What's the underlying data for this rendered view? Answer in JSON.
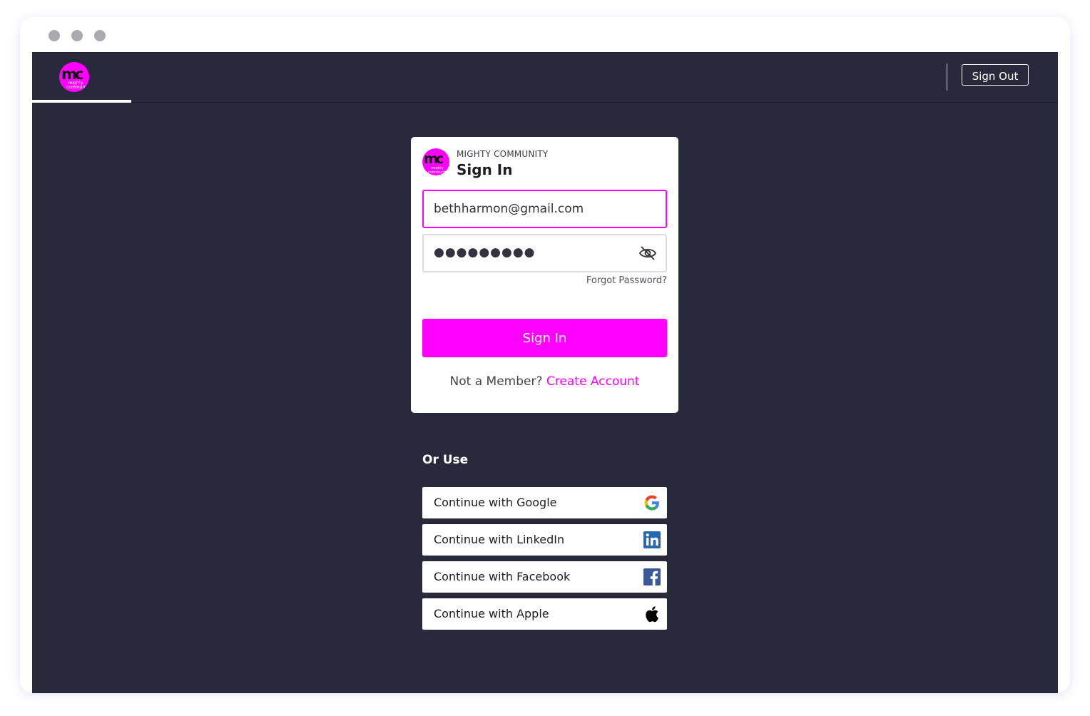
{
  "header": {
    "logo_text": "mc",
    "logo_subtext": "mighty community",
    "signout_label": "Sign Out"
  },
  "card": {
    "brand": "MIGHTY COMMUNITY",
    "title": "Sign In",
    "email_value": "bethharmon@gmail.com",
    "password_mask": "●●●●●●●●●",
    "forgot_label": "Forgot Password?",
    "signin_label": "Sign In",
    "member_prompt": "Not a Member?",
    "create_account_label": "Create Account"
  },
  "social": {
    "heading": "Or Use",
    "options": [
      {
        "label": "Continue with Google",
        "icon": "google-icon"
      },
      {
        "label": "Continue with LinkedIn",
        "icon": "linkedin-icon"
      },
      {
        "label": "Continue with Facebook",
        "icon": "facebook-icon"
      },
      {
        "label": "Continue with Apple",
        "icon": "apple-icon"
      }
    ]
  },
  "colors": {
    "accent": "#ff00ff",
    "background": "#282a3b",
    "linkedin": "#2867b2",
    "facebook": "#3b5998"
  }
}
